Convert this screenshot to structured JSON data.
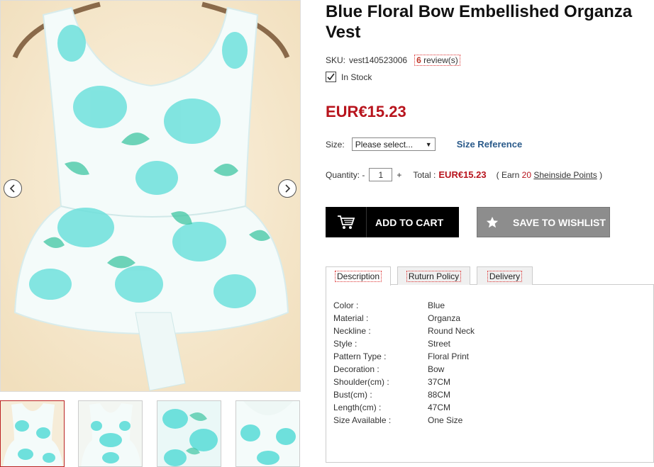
{
  "gallery": {
    "prev_icon": "chevron-left-icon",
    "next_icon": "chevron-right-icon",
    "thumbnails": [
      "thumb-front",
      "thumb-back-bow",
      "thumb-fabric-closeup",
      "thumb-back-closeup"
    ]
  },
  "product": {
    "title": "Blue Floral Bow Embellished Organza Vest",
    "sku_label": "SKU:",
    "sku": "vest140523006",
    "review_count": "6",
    "review_label": "review(s)",
    "stock": "In Stock",
    "price": "EUR€15.23"
  },
  "size": {
    "label": "Size:",
    "selected": "Please select...",
    "reference": "Size Reference"
  },
  "quantity": {
    "label": "Quantity: -",
    "value": "1",
    "plus": "+",
    "total_label": "Total :",
    "total": "EUR€15.23",
    "earn_prefix": "( Earn",
    "earn_points": "20",
    "earn_link": "Sheinside Points",
    "earn_suffix": ")"
  },
  "buttons": {
    "cart": "ADD TO CART",
    "wishlist": "SAVE TO WISHLIST"
  },
  "tabs": [
    "Description",
    "Ruturn Policy",
    "Delivery"
  ],
  "specs": [
    {
      "k": "Color :",
      "v": "Blue"
    },
    {
      "k": "Material :",
      "v": "Organza"
    },
    {
      "k": "Neckline :",
      "v": "Round Neck"
    },
    {
      "k": "Style :",
      "v": "Street"
    },
    {
      "k": "Pattern Type :",
      "v": "Floral Print"
    },
    {
      "k": "Decoration :",
      "v": "Bow"
    },
    {
      "k": "Shoulder(cm) :",
      "v": "37CM"
    },
    {
      "k": "Bust(cm) :",
      "v": "88CM"
    },
    {
      "k": "Length(cm) :",
      "v": "47CM"
    },
    {
      "k": "Size Available :",
      "v": "One Size"
    }
  ],
  "colors": {
    "price": "#b8141d",
    "cart_button": "#000000",
    "wishlist_button": "#8d8d8d",
    "link": "#2a5a8a",
    "floral": "#5fd8d6"
  }
}
